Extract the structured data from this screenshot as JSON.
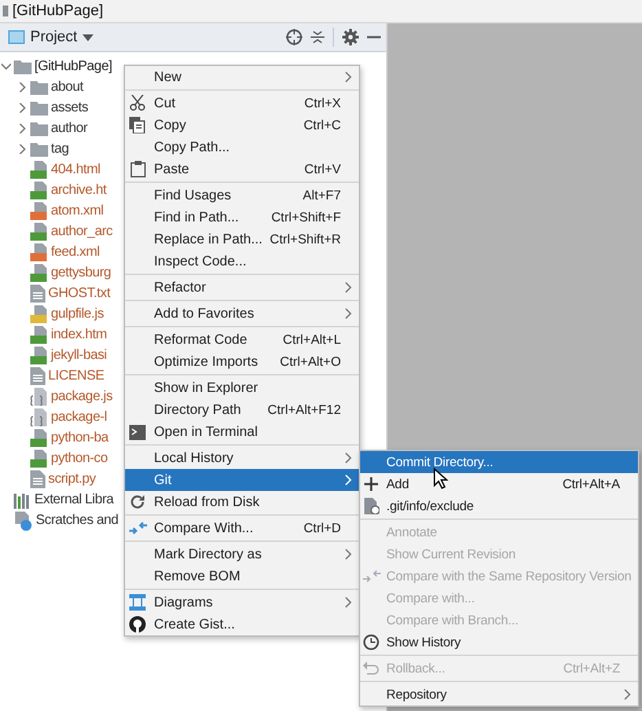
{
  "window": {
    "title": "[GitHubPage]"
  },
  "panel": {
    "title": "Project"
  },
  "tree": [
    {
      "label": "[GitHubPage]",
      "kind": "folder",
      "expanded": true,
      "color": "#222222",
      "children": [
        {
          "label": "about",
          "kind": "folder",
          "expanded": false,
          "color": "#333333"
        },
        {
          "label": "assets",
          "kind": "folder",
          "expanded": false,
          "color": "#333333"
        },
        {
          "label": "author",
          "kind": "folder",
          "expanded": false,
          "color": "#333333"
        },
        {
          "label": "tag",
          "kind": "folder",
          "expanded": false,
          "color": "#333333"
        },
        {
          "label": "404.html",
          "kind": "html",
          "color": "#b5582a"
        },
        {
          "label": "archive.ht",
          "kind": "html",
          "color": "#b5582a"
        },
        {
          "label": "atom.xml",
          "kind": "xml",
          "color": "#b5582a"
        },
        {
          "label": "author_arc",
          "kind": "html",
          "color": "#b5582a"
        },
        {
          "label": "feed.xml",
          "kind": "xml",
          "color": "#b5582a"
        },
        {
          "label": "gettysburg",
          "kind": "html",
          "color": "#b5582a"
        },
        {
          "label": "GHOST.txt",
          "kind": "text",
          "color": "#b5582a"
        },
        {
          "label": "gulpfile.js",
          "kind": "js",
          "color": "#b5582a"
        },
        {
          "label": "index.htm",
          "kind": "html",
          "color": "#b5582a"
        },
        {
          "label": "jekyll-basi",
          "kind": "html",
          "color": "#b5582a"
        },
        {
          "label": "LICENSE",
          "kind": "text",
          "color": "#b5582a"
        },
        {
          "label": "package.js",
          "kind": "json",
          "color": "#b5582a"
        },
        {
          "label": "package-l",
          "kind": "json",
          "color": "#b5582a"
        },
        {
          "label": "python-ba",
          "kind": "html",
          "color": "#b5582a"
        },
        {
          "label": "python-co",
          "kind": "html",
          "color": "#b5582a"
        },
        {
          "label": "script.py",
          "kind": "text",
          "color": "#b5582a"
        }
      ]
    },
    {
      "label": "External Libra",
      "kind": "library",
      "color": "#333333"
    },
    {
      "label": "Scratches and",
      "kind": "scratches",
      "color": "#333333"
    }
  ],
  "main_menu": {
    "items": [
      {
        "kind": "item",
        "label": "New",
        "submenu": true,
        "selected": false
      },
      {
        "kind": "separator"
      },
      {
        "kind": "item",
        "label": "Cut",
        "shortcut": "Ctrl+X",
        "selected": false
      },
      {
        "kind": "item",
        "label": "Copy",
        "shortcut": "Ctrl+C",
        "selected": false
      },
      {
        "kind": "item",
        "label": "Copy Path...",
        "selected": false
      },
      {
        "kind": "item",
        "label": "Paste",
        "shortcut": "Ctrl+V",
        "selected": false
      },
      {
        "kind": "separator"
      },
      {
        "kind": "item",
        "label": "Find Usages",
        "shortcut": "Alt+F7",
        "selected": false
      },
      {
        "kind": "item",
        "label": "Find in Path...",
        "shortcut": "Ctrl+Shift+F",
        "selected": false
      },
      {
        "kind": "item",
        "label": "Replace in Path...",
        "shortcut": "Ctrl+Shift+R",
        "selected": false
      },
      {
        "kind": "item",
        "label": "Inspect Code...",
        "selected": false
      },
      {
        "kind": "separator"
      },
      {
        "kind": "item",
        "label": "Refactor",
        "submenu": true,
        "selected": false
      },
      {
        "kind": "separator"
      },
      {
        "kind": "item",
        "label": "Add to Favorites",
        "submenu": true,
        "selected": false
      },
      {
        "kind": "separator"
      },
      {
        "kind": "item",
        "label": "Reformat Code",
        "shortcut": "Ctrl+Alt+L",
        "selected": false
      },
      {
        "kind": "item",
        "label": "Optimize Imports",
        "shortcut": "Ctrl+Alt+O",
        "selected": false
      },
      {
        "kind": "separator"
      },
      {
        "kind": "item",
        "label": "Show in Explorer",
        "selected": false
      },
      {
        "kind": "item",
        "label": "Directory Path",
        "shortcut": "Ctrl+Alt+F12",
        "selected": false
      },
      {
        "kind": "item",
        "label": "Open in Terminal",
        "selected": false
      },
      {
        "kind": "separator"
      },
      {
        "kind": "item",
        "label": "Local History",
        "submenu": true,
        "selected": false
      },
      {
        "kind": "item",
        "label": "Git",
        "submenu": true,
        "selected": true
      },
      {
        "kind": "item",
        "label": "Reload from Disk",
        "selected": false
      },
      {
        "kind": "separator"
      },
      {
        "kind": "item",
        "label": "Compare With...",
        "shortcut": "Ctrl+D",
        "selected": false
      },
      {
        "kind": "separator"
      },
      {
        "kind": "item",
        "label": "Mark Directory as",
        "submenu": true,
        "selected": false
      },
      {
        "kind": "item",
        "label": "Remove BOM",
        "selected": false
      },
      {
        "kind": "separator"
      },
      {
        "kind": "item",
        "label": "Diagrams",
        "submenu": true,
        "selected": false
      },
      {
        "kind": "item",
        "label": "Create Gist...",
        "selected": false
      }
    ]
  },
  "git_menu": {
    "items": [
      {
        "kind": "item",
        "label": "Commit Directory...",
        "selected": true,
        "disabled": false
      },
      {
        "kind": "item",
        "label": "Add",
        "shortcut": "Ctrl+Alt+A",
        "selected": false,
        "disabled": false
      },
      {
        "kind": "item",
        "label": ".git/info/exclude",
        "selected": false,
        "disabled": false
      },
      {
        "kind": "separator"
      },
      {
        "kind": "item",
        "label": "Annotate",
        "selected": false,
        "disabled": true
      },
      {
        "kind": "item",
        "label": "Show Current Revision",
        "selected": false,
        "disabled": true
      },
      {
        "kind": "item",
        "label": "Compare with the Same Repository Version",
        "selected": false,
        "disabled": true
      },
      {
        "kind": "item",
        "label": "Compare with...",
        "selected": false,
        "disabled": true
      },
      {
        "kind": "item",
        "label": "Compare with Branch...",
        "selected": false,
        "disabled": true
      },
      {
        "kind": "item",
        "label": "Show History",
        "selected": false,
        "disabled": false
      },
      {
        "kind": "separator"
      },
      {
        "kind": "item",
        "label": "Rollback...",
        "shortcut": "Ctrl+Alt+Z",
        "selected": false,
        "disabled": true
      },
      {
        "kind": "separator"
      },
      {
        "kind": "item",
        "label": "Repository",
        "submenu": true,
        "selected": false,
        "disabled": false
      }
    ]
  }
}
